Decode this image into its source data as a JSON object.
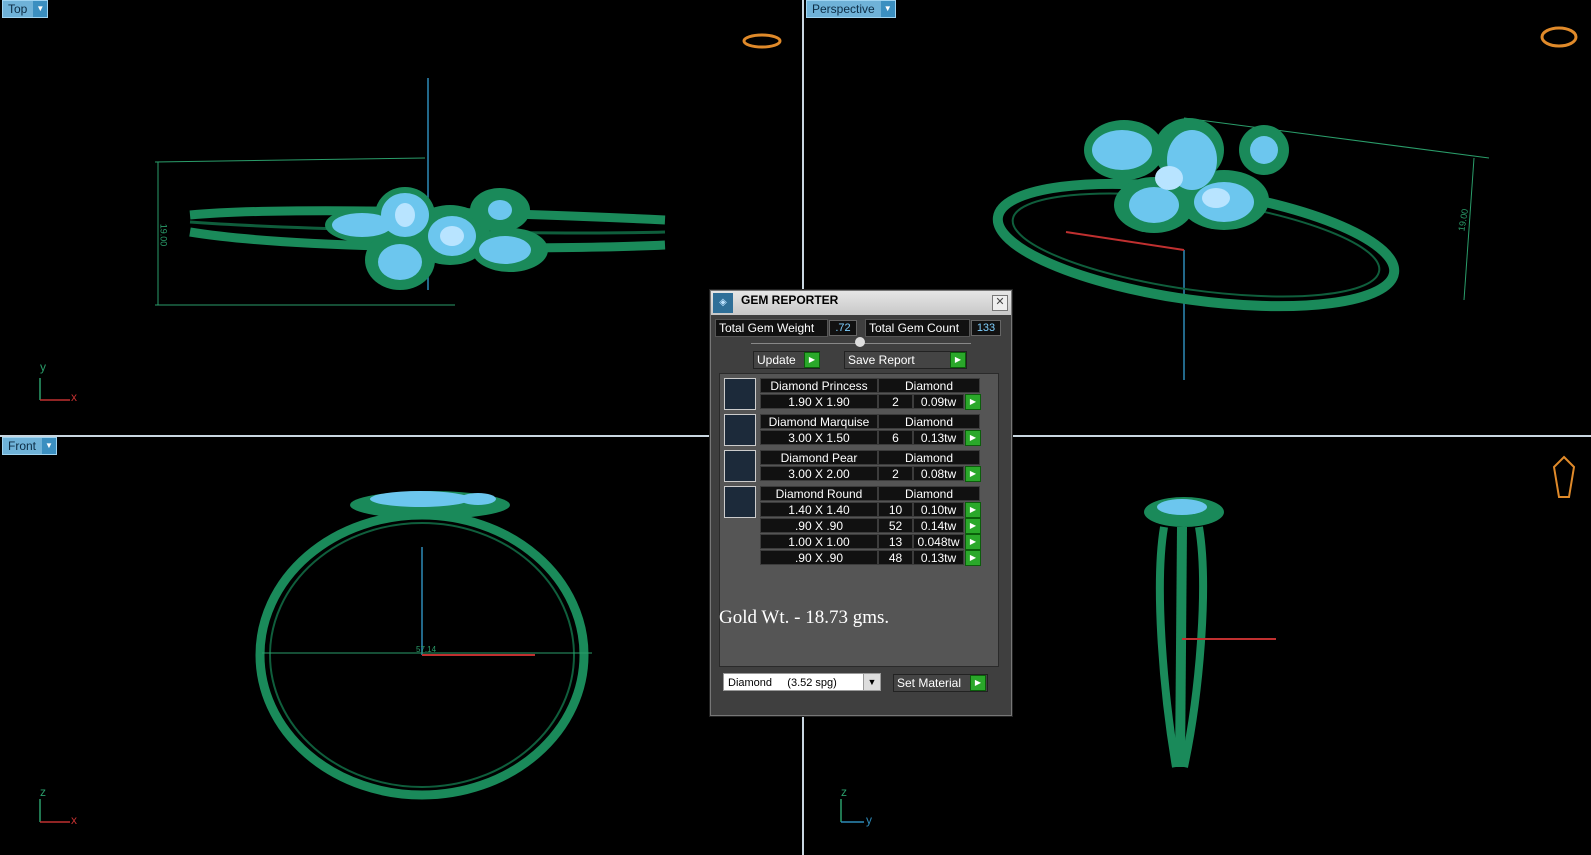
{
  "viewports": {
    "top": {
      "label": "Top",
      "axis_a": "y",
      "axis_b": "x",
      "dimension": "19.00"
    },
    "perspective": {
      "label": "Perspective",
      "dimension": "19.00"
    },
    "front": {
      "label": "Front",
      "axis_a": "z",
      "axis_b": "x",
      "dimension": "57.14"
    },
    "right": {
      "axis_a": "z",
      "axis_b": "y"
    }
  },
  "gem_reporter": {
    "title": "GEM REPORTER",
    "total_weight_label": "Total Gem Weight",
    "total_weight_value": ".72",
    "total_count_label": "Total Gem Count",
    "total_count_value": "133",
    "update_label": "Update",
    "save_report_label": "Save Report",
    "rows": [
      {
        "name": "Diamond Princess",
        "material": "Diamond",
        "sizes": [
          {
            "size": "1.90 X 1.90",
            "count": "2",
            "weight": "0.09tw"
          }
        ]
      },
      {
        "name": "Diamond Marquise",
        "material": "Diamond",
        "sizes": [
          {
            "size": "3.00 X 1.50",
            "count": "6",
            "weight": "0.13tw"
          }
        ]
      },
      {
        "name": "Diamond Pear",
        "material": "Diamond",
        "sizes": [
          {
            "size": "3.00 X 2.00",
            "count": "2",
            "weight": "0.08tw"
          }
        ]
      },
      {
        "name": "Diamond Round",
        "material": "Diamond",
        "sizes": [
          {
            "size": "1.40 X 1.40",
            "count": "10",
            "weight": "0.10tw"
          },
          {
            "size": ".90 X .90",
            "count": "52",
            "weight": "0.14tw"
          },
          {
            "size": "1.00 X 1.00",
            "count": "13",
            "weight": "0.048tw"
          },
          {
            "size": ".90 X .90",
            "count": "48",
            "weight": "0.13tw"
          }
        ]
      }
    ],
    "gold_weight": "Gold Wt. - 18.73 gms.",
    "material_select": "Diamond     (3.52 spg)",
    "set_material_label": "Set Material"
  },
  "colors": {
    "metal": "#1a8a5a",
    "gem": "#6cc6ee",
    "label_bg": "#6fb2d8"
  }
}
